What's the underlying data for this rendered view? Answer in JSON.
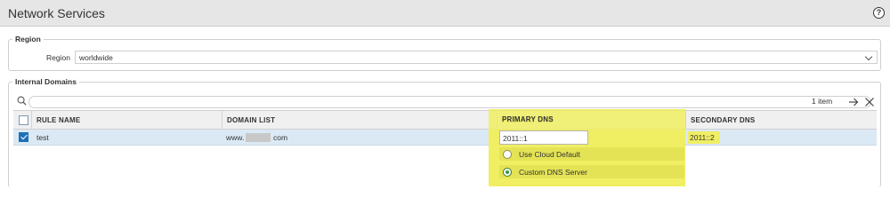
{
  "window": {
    "title": "Network Services",
    "help_icon": "help-icon"
  },
  "region": {
    "legend": "Region",
    "label": "Region",
    "value": "worldwide"
  },
  "internal_domains": {
    "legend": "Internal Domains",
    "search": {
      "placeholder": "",
      "count": "1 item"
    },
    "columns": {
      "rule_name": "RULE NAME",
      "domain_list": "DOMAIN LIST",
      "primary_dns": "PRIMARY DNS",
      "secondary_dns": "SECONDARY DNS"
    },
    "rows": [
      {
        "checked": true,
        "rule_name": "test",
        "domain_prefix": "www.",
        "domain_suffix": "com",
        "primary_dns": "2011::1",
        "secondary_dns": "2011::2"
      }
    ],
    "dns_options": [
      {
        "label": "Use Cloud Default",
        "selected": false
      },
      {
        "label": "Custom DNS Server",
        "selected": true
      }
    ]
  },
  "colors": {
    "highlight": "#f0ee63",
    "selected_row": "#dbe9f5",
    "checkbox_checked": "#1d6fb8"
  }
}
